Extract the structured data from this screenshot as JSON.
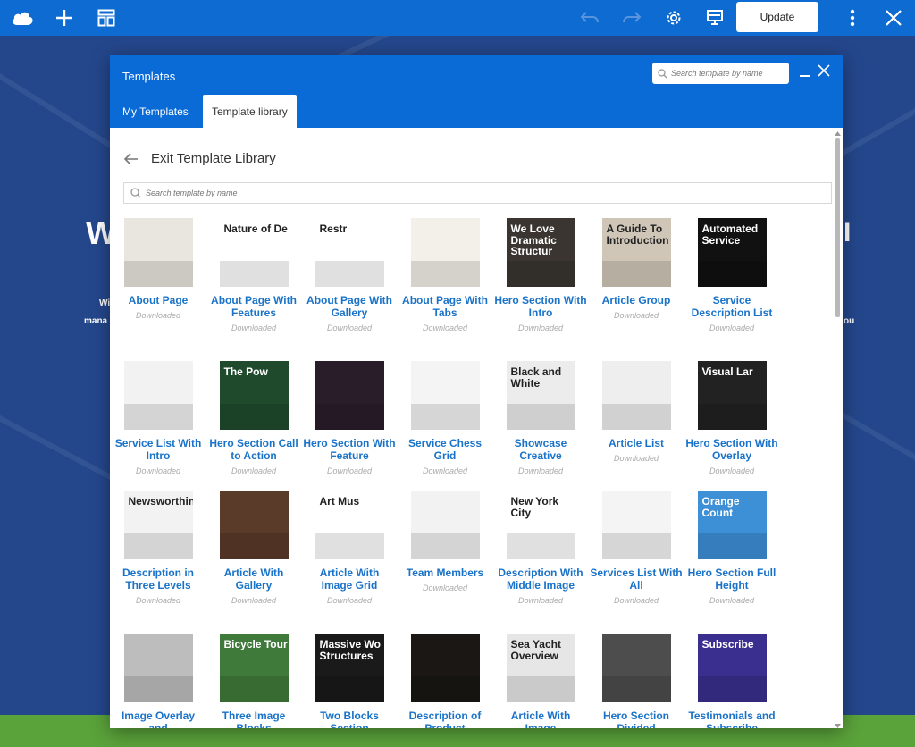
{
  "toolbar": {
    "update_label": "Update",
    "icons": [
      "cloud-logo-icon",
      "add-icon",
      "layout-icon",
      "undo-icon",
      "redo-icon",
      "gear-icon",
      "desktop-icon",
      "more-vert-icon",
      "close-icon"
    ]
  },
  "background": {
    "heading_fragment": "W",
    "heading_fragment_right": "I",
    "line1_fragment": "Wi",
    "line2_fragment": "mana",
    "line2_right": "ou"
  },
  "modal": {
    "title": "Templates",
    "header_search_placeholder": "Search template by name",
    "tabs": [
      {
        "label": "My Templates",
        "active": false
      },
      {
        "label": "Template library",
        "active": true
      }
    ],
    "back_label": "Exit Template Library",
    "library_search_placeholder": "Search template by name"
  },
  "templates": [
    {
      "title": "About Page",
      "status": "Downloaded",
      "thumb_text": "",
      "bg": "#e9e5df",
      "fg": "#222"
    },
    {
      "title": "About Page With Features",
      "status": "Downloaded",
      "thumb_text": "Nature of De",
      "bg": "#ffffff",
      "fg": "#222"
    },
    {
      "title": "About Page With Gallery",
      "status": "Downloaded",
      "thumb_text": "Restr",
      "bg": "#ffffff",
      "fg": "#222"
    },
    {
      "title": "About Page With Tabs",
      "status": "Downloaded",
      "thumb_text": "",
      "bg": "#f3efe9",
      "fg": "#222"
    },
    {
      "title": "Hero Section With Intro",
      "status": "Downloaded",
      "thumb_text": "We Love Dramatic Structur",
      "bg": "#3a3530",
      "fg": "#ffffff"
    },
    {
      "title": "Article Group",
      "status": "Downloaded",
      "thumb_text": "A Guide To Introduction",
      "bg": "#cfc6b8",
      "fg": "#222"
    },
    {
      "title": "Service Description List",
      "status": "Downloaded",
      "thumb_text": "Automated Service",
      "bg": "#111111",
      "fg": "#ffffff"
    },
    {
      "title": "Service List With Intro",
      "status": "Downloaded",
      "thumb_text": "",
      "bg": "#f2f2f2",
      "fg": "#222"
    },
    {
      "title": "Hero Section Call to Action",
      "status": "Downloaded",
      "thumb_text": "The Pow",
      "bg": "#1f4a2c",
      "fg": "#ffffff"
    },
    {
      "title": "Hero Section With Feature",
      "status": "Downloaded",
      "thumb_text": "",
      "bg": "#2a1d2a",
      "fg": "#ffffff"
    },
    {
      "title": "Service Chess Grid",
      "status": "Downloaded",
      "thumb_text": "",
      "bg": "#f4f4f4",
      "fg": "#222"
    },
    {
      "title": "Showcase Creative",
      "status": "Downloaded",
      "thumb_text": "Black and White",
      "bg": "#ececec",
      "fg": "#222"
    },
    {
      "title": "Article List",
      "status": "Downloaded",
      "thumb_text": "",
      "bg": "#eeeeee",
      "fg": "#222"
    },
    {
      "title": "Hero Section With Overlay",
      "status": "Downloaded",
      "thumb_text": "Visual Lar",
      "bg": "#222222",
      "fg": "#ffffff"
    },
    {
      "title": "Description in Three Levels",
      "status": "Downloaded",
      "thumb_text": "Newsworthin",
      "bg": "#f2f2f2",
      "fg": "#222"
    },
    {
      "title": "Article With Gallery",
      "status": "Downloaded",
      "thumb_text": "",
      "bg": "#5a3a28",
      "fg": "#ffffff"
    },
    {
      "title": "Article With Image Grid",
      "status": "Downloaded",
      "thumb_text": "Art Mus",
      "bg": "#ffffff",
      "fg": "#222"
    },
    {
      "title": "Team Members",
      "status": "Downloaded",
      "thumb_text": "",
      "bg": "#f2f2f2",
      "fg": "#222"
    },
    {
      "title": "Description With Middle Image",
      "status": "Downloaded",
      "thumb_text": "New York City",
      "bg": "#ffffff",
      "fg": "#222"
    },
    {
      "title": "Services List With All",
      "status": "Downloaded",
      "thumb_text": "",
      "bg": "#f4f4f4",
      "fg": "#222"
    },
    {
      "title": "Hero Section Full Height",
      "status": "Downloaded",
      "thumb_text": "Orange Count",
      "bg": "#3d8fd6",
      "fg": "#ffffff"
    },
    {
      "title": "Image Overlay and",
      "status": "",
      "thumb_text": "",
      "bg": "#bdbdbd",
      "fg": "#222"
    },
    {
      "title": "Three Image Blocks",
      "status": "",
      "thumb_text": "Bicycle Tour",
      "bg": "#3f7a3a",
      "fg": "#ffffff"
    },
    {
      "title": "Two Blocks Section",
      "status": "",
      "thumb_text": "Massive Wo Structures",
      "bg": "#1a1a1a",
      "fg": "#ffffff"
    },
    {
      "title": "Description of Product",
      "status": "",
      "thumb_text": "",
      "bg": "#1a1714",
      "fg": "#ffffff"
    },
    {
      "title": "Article With Image",
      "status": "",
      "thumb_text": "Sea Yacht Overview",
      "bg": "#e6e6e6",
      "fg": "#222"
    },
    {
      "title": "Hero Section Divided",
      "status": "",
      "thumb_text": "",
      "bg": "#4d4d4d",
      "fg": "#ffffff"
    },
    {
      "title": "Testimonials and Subscribe",
      "status": "",
      "thumb_text": "Subscribe",
      "bg": "#3a2f8f",
      "fg": "#ffffff"
    }
  ]
}
